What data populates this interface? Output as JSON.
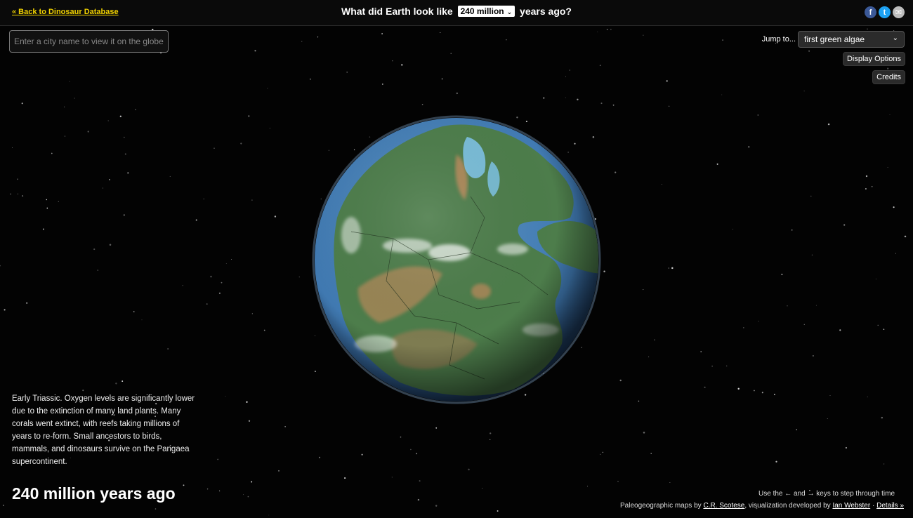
{
  "header": {
    "back_link": "« Back to Dinosaur Database",
    "title_before": "What did Earth look like",
    "year_selected": "240 million",
    "title_after": "years ago?",
    "social": {
      "facebook": "f",
      "twitter": "t",
      "email": "✉"
    }
  },
  "search": {
    "placeholder": "Enter a city name to view it on the globe"
  },
  "controls": {
    "jump_label": "Jump to...",
    "jump_selected": "first green algae",
    "display_options": "Display Options",
    "credits": "Credits"
  },
  "info": {
    "description": "Early Triassic. Oxygen levels are significantly lower due to the extinction of many land plants. Many corals went extinct, with reefs taking millions of years to re-form. Small ancestors to birds, mammals, and dinosaurs survive on the Pangaea supercontinent.",
    "era": "240 million years ago"
  },
  "footer": {
    "hint": "Use the ← and → keys to step through time",
    "credits_prefix": "Paleogeographic maps by",
    "credits_scotese": "C.R. Scotese",
    "credits_middle": ", visualization developed by",
    "credits_webster": "Ian Webster",
    "credits_sep": "·",
    "details": "Details »"
  },
  "colors": {
    "link_yellow": "#f2d300",
    "ocean": "#3f78b0",
    "land": "#4d7d4b",
    "highland": "#b9895a"
  }
}
